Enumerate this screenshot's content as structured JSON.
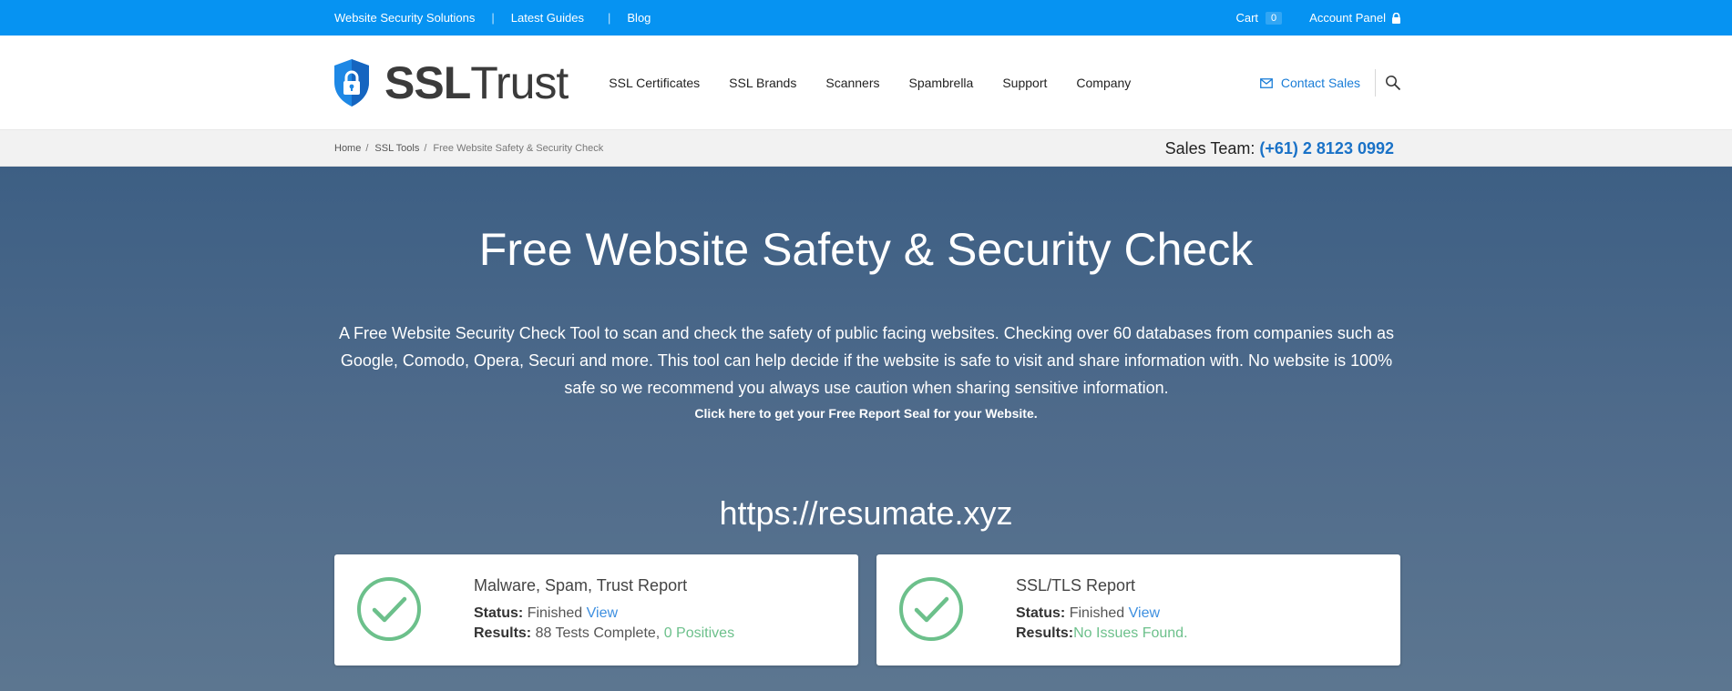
{
  "topbar": {
    "links": [
      "Website Security Solutions",
      "Latest Guides",
      "Blog"
    ],
    "cart_label": "Cart",
    "cart_count": "0",
    "account_label": "Account Panel",
    "icon": "lock-icon"
  },
  "header": {
    "logo_bold": "SSL",
    "logo_light": "Trust",
    "nav": [
      "SSL Certificates",
      "SSL Brands",
      "Scanners",
      "Spambrella",
      "Support",
      "Company"
    ],
    "contact_label": "Contact Sales",
    "icons": [
      "shield-lock-icon",
      "mail-icon",
      "search-icon"
    ]
  },
  "breadcrumb": {
    "items": [
      "Home",
      "SSL Tools"
    ],
    "current": "Free Website Safety & Security Check",
    "separator": "/"
  },
  "sales": {
    "label": "Sales Team:",
    "phone": "(+61) 2 8123 0992"
  },
  "hero": {
    "title": "Free Website Safety & Security Check",
    "description": "A Free Website Security Check Tool to scan and check the safety of public facing websites. Checking over 60 databases from companies such as Google, Comodo, Opera, Securi and more. This tool can help decide if the website is safe to visit and share information with. No website is 100% safe so we recommend you always use caution when sharing sensitive information.",
    "seal_link": "Click here to get your Free Report Seal for your Website.",
    "url": "https://resumate.xyz"
  },
  "cards": [
    {
      "title": "Malware, Spam, Trust Report",
      "status_label": "Status:",
      "status_value": "Finished",
      "view_label": "View",
      "results_label": "Results:",
      "results_value": "88 Tests Complete,",
      "results_highlight": "0 Positives",
      "icon": "check-circle-icon"
    },
    {
      "title": "SSL/TLS Report",
      "status_label": "Status:",
      "status_value": "Finished",
      "view_label": "View",
      "results_label": "Results:",
      "results_value": "",
      "results_highlight": "No Issues Found.",
      "icon": "check-circle-icon"
    }
  ],
  "colors": {
    "topbar": "#0693f2",
    "accent_blue": "#1a72c7",
    "link_blue": "#3d8fe0",
    "success_green": "#6cc08b",
    "hero_dark": "#3d5f84",
    "hero_light": "#5c7690"
  }
}
